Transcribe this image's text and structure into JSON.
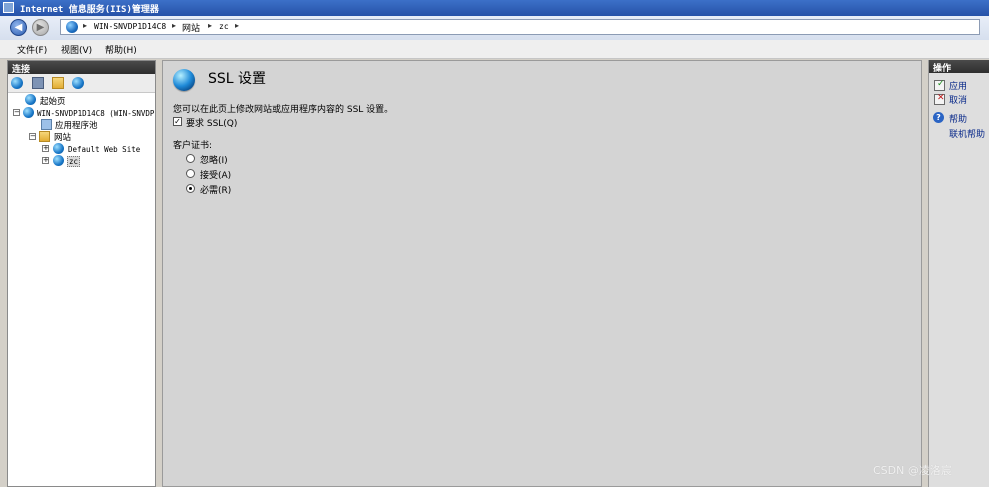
{
  "window": {
    "title": "Internet 信息服务(IIS)管理器"
  },
  "address": {
    "crumbs": [
      "WIN-SNVDP1D14C8",
      "网站",
      "zc"
    ]
  },
  "menu": [
    "文件(F)",
    "视图(V)",
    "帮助(H)"
  ],
  "connections": {
    "header": "连接",
    "tree": {
      "start_page": "起始页",
      "server": "WIN-SNVDP1D14C8 (WIN-SNVDP",
      "app_pools": "应用程序池",
      "sites": "网站",
      "default_site": "Default Web Site",
      "zc": "zc"
    }
  },
  "main": {
    "title": "SSL 设置",
    "description": "您可以在此页上修改网站或应用程序内容的 SSL 设置。",
    "require_ssl": {
      "label": "要求 SSL(Q)",
      "checked": true
    },
    "client_cert_label": "客户证书:",
    "options": [
      {
        "label": "忽略(I)",
        "selected": false
      },
      {
        "label": "接受(A)",
        "selected": false
      },
      {
        "label": "必需(R)",
        "selected": true
      }
    ]
  },
  "actions": {
    "header": "操作",
    "apply": "应用",
    "cancel": "取消",
    "help": "帮助",
    "online_help": "联机帮助"
  },
  "watermark": "CSDN @凌洛宸",
  "colors": {
    "title_bar": "#2652a8",
    "panel_header": "#333333",
    "action_link": "#0a2a8a"
  }
}
